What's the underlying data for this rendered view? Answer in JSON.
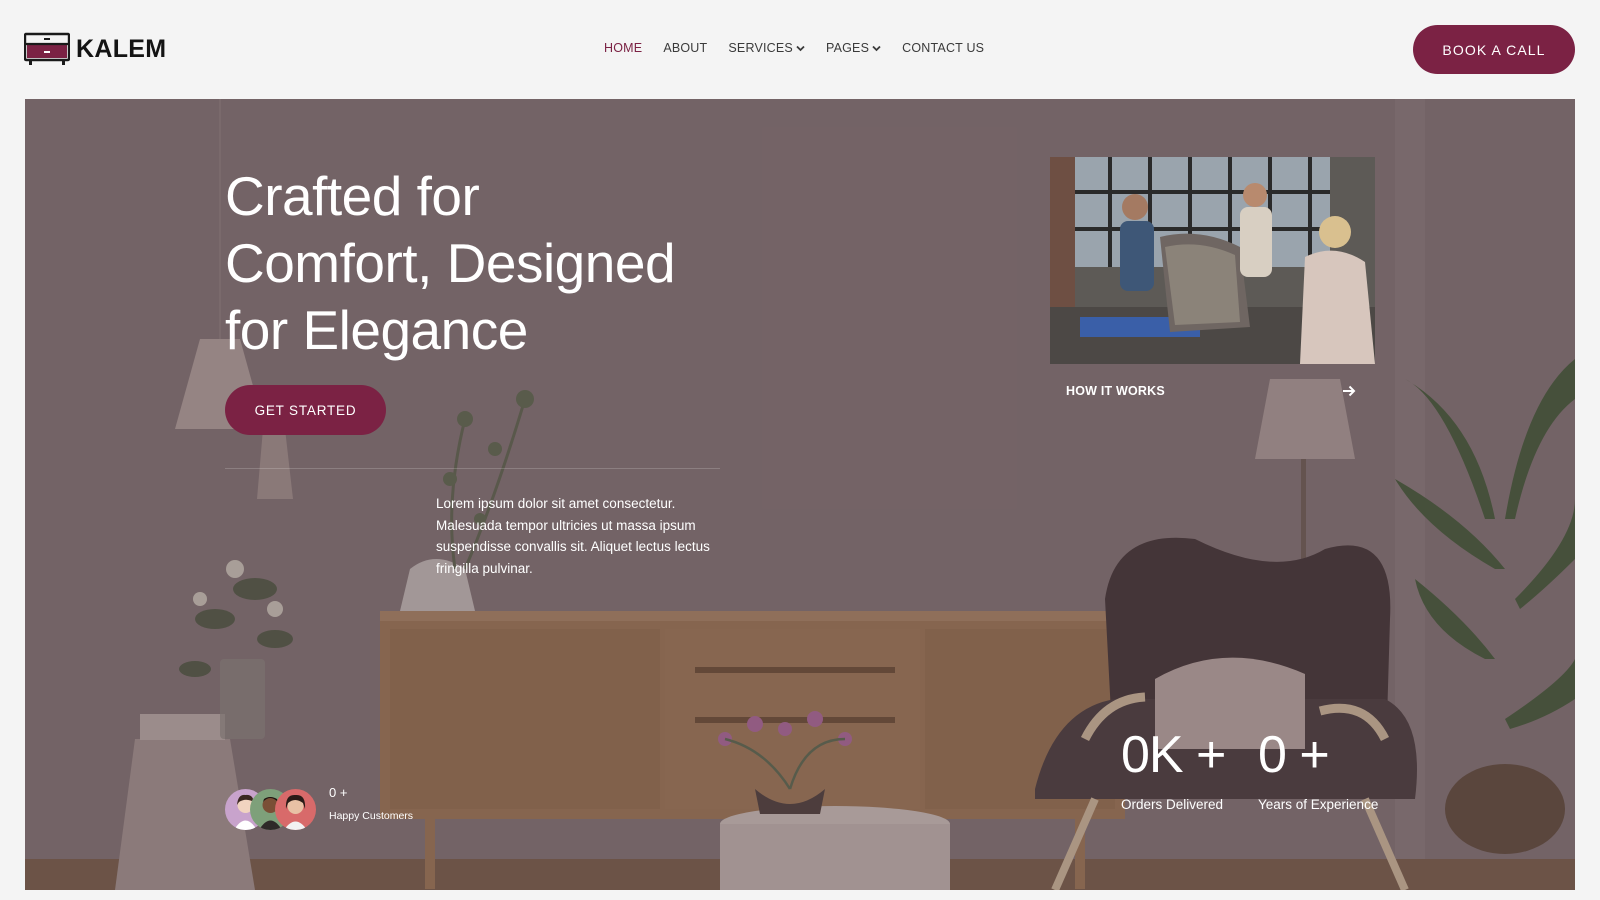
{
  "brand": {
    "name": "KALEM",
    "accent": "#7b2244"
  },
  "nav": {
    "items": [
      {
        "label": "HOME",
        "active": true,
        "dropdown": false
      },
      {
        "label": "ABOUT",
        "active": false,
        "dropdown": false
      },
      {
        "label": "SERVICES",
        "active": false,
        "dropdown": true
      },
      {
        "label": "PAGES",
        "active": false,
        "dropdown": true
      },
      {
        "label": "CONTACT US",
        "active": false,
        "dropdown": false
      }
    ],
    "cta_label": "BOOK A CALL"
  },
  "hero": {
    "title_lines": [
      "Crafted for",
      "Comfort, Designed",
      "for Elegance"
    ],
    "cta_label": "GET STARTED",
    "description": "Lorem ipsum dolor sit amet consectetur. Malesuada tempor ultricies ut massa ipsum suspendisse convallis sit. Aliquet lectus lectus fringilla pulvinar.",
    "how_it_works_label": "HOW IT WORKS",
    "customers": {
      "count": "0 +",
      "label": "Happy Customers"
    },
    "stats": [
      {
        "value": "0K +",
        "label": "Orders Delivered"
      },
      {
        "value": "0 +",
        "label": "Years of Experience"
      }
    ]
  }
}
